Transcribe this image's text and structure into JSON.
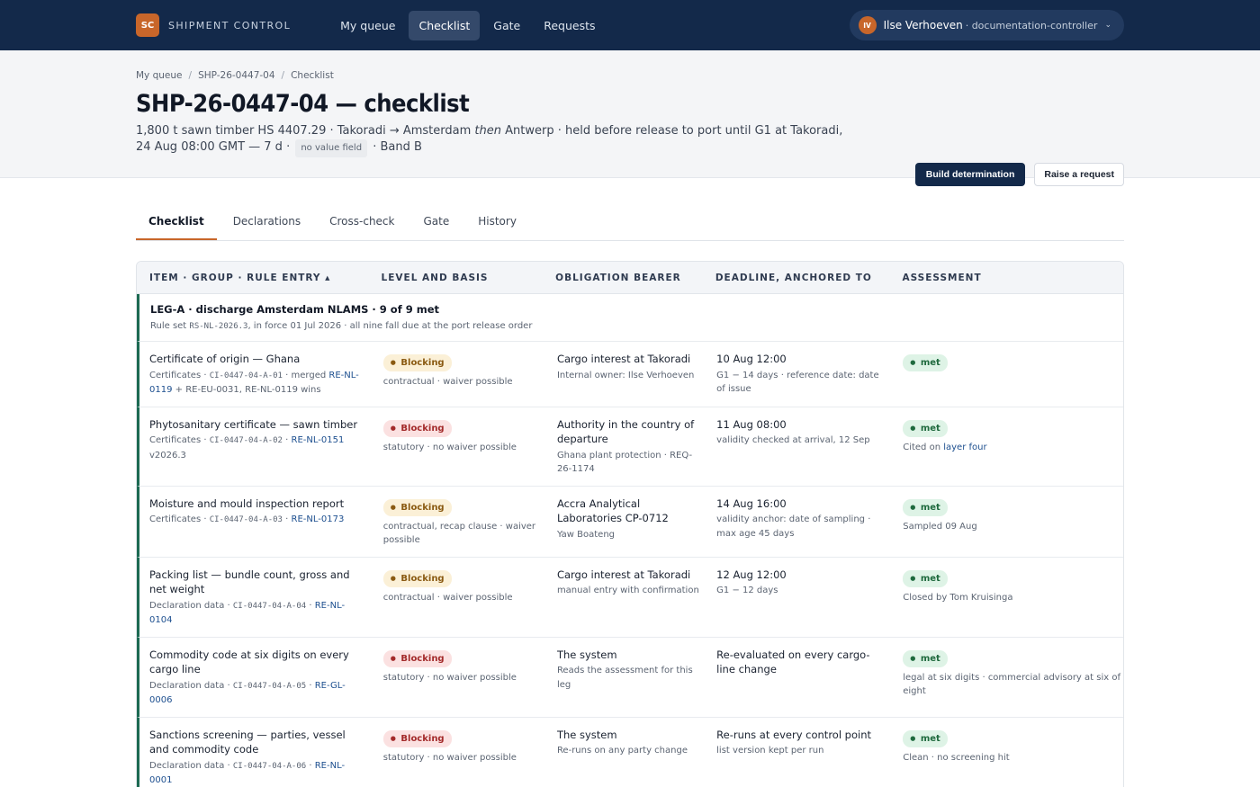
{
  "app": {
    "logo": "SC",
    "brand": "SHIPMENT CONTROL"
  },
  "nav": [
    "My queue",
    "Checklist",
    "Gate",
    "Requests"
  ],
  "user": {
    "initials": "IV",
    "name": "Ilse Verhoeven",
    "role": "· documentation-controller"
  },
  "breadcrumb": [
    "My queue",
    "SHP-26-0447-04",
    "Checklist"
  ],
  "page": {
    "title": "SHP-26-0447-04 — checklist",
    "subtitle_a": "1,800 t sawn timber HS 4407.29 · Takoradi → Amsterdam ",
    "subtitle_then": "then",
    "subtitle_b": " Antwerp · held before release to port until G1 at Takoradi, 24 Aug 08:00 GMT — 7 d ·",
    "pill": "no value field",
    "subtitle_c": "· Band B"
  },
  "actions": {
    "primary": "Build determination",
    "secondary": "Raise a request"
  },
  "tabs": [
    "Checklist",
    "Declarations",
    "Cross-check",
    "Gate",
    "History"
  ],
  "columns": [
    "ITEM · GROUP · RULE ENTRY ▴",
    "LEVEL AND BASIS",
    "OBLIGATION BEARER",
    "DEADLINE, ANCHORED TO",
    "ASSESSMENT"
  ],
  "group": {
    "title": "LEG-A · discharge Amsterdam NLAMS · 9 of 9 met",
    "sub_a": "Rule set ",
    "sub_code": "RS-NL-2026.3",
    "sub_b": ", in force 01 Jul 2026 · all nine fall due at the port release order"
  },
  "rows": [
    {
      "item": "Certificate of origin — Ghana",
      "meta_a": "Certificates · ",
      "code": "CI-0447-04-A-01",
      "meta_b": " · merged ",
      "link": "RE-NL-0119",
      "meta_c": " + RE-EU-0031, RE-NL-0119 wins",
      "badge": "Blocking",
      "tone": "amber",
      "basis": "contractual · waiver possible",
      "bearer": "Cargo interest at Takoradi",
      "bearer_sub": "Internal owner: Ilse Verhoeven",
      "deadline": "10 Aug 12:00",
      "deadline_sub": "G1 − 14 days · reference date: date of issue",
      "status": "met",
      "note_a": "",
      "note_link": "",
      "note_b": ""
    },
    {
      "item": "Phytosanitary certificate — sawn timber",
      "meta_a": "Certificates · ",
      "code": "CI-0447-04-A-02",
      "meta_b": " · ",
      "link": "RE-NL-0151",
      "meta_c": " v2026.3",
      "badge": "Blocking",
      "tone": "red",
      "basis": "statutory · no waiver possible",
      "bearer": "Authority in the country of departure",
      "bearer_sub": "Ghana plant protection · REQ-26-1174",
      "deadline": "11 Aug 08:00",
      "deadline_sub": "validity checked at arrival, 12 Sep",
      "status": "met",
      "note_a": "Cited on ",
      "note_link": "layer four",
      "note_b": ""
    },
    {
      "item": "Moisture and mould inspection report",
      "meta_a": "Certificates · ",
      "code": "CI-0447-04-A-03",
      "meta_b": " · ",
      "link": "RE-NL-0173",
      "meta_c": "",
      "badge": "Blocking",
      "tone": "amber",
      "basis": "contractual, recap clause · waiver possible",
      "bearer": "Accra Analytical Laboratories CP-0712",
      "bearer_sub": "Yaw Boateng",
      "deadline": "14 Aug 16:00",
      "deadline_sub": "validity anchor: date of sampling · max age 45 days",
      "status": "met",
      "note_a": "Sampled 09 Aug",
      "note_link": "",
      "note_b": ""
    },
    {
      "item": "Packing list — bundle count, gross and net weight",
      "meta_a": "Declaration data · ",
      "code": "CI-0447-04-A-04",
      "meta_b": " · ",
      "link": "RE-NL-0104",
      "meta_c": "",
      "badge": "Blocking",
      "tone": "amber",
      "basis": "contractual · waiver possible",
      "bearer": "Cargo interest at Takoradi",
      "bearer_sub": "manual entry with confirmation",
      "deadline": "12 Aug 12:00",
      "deadline_sub": "G1 − 12 days",
      "status": "met",
      "note_a": "Closed by Tom Kruisinga",
      "note_link": "",
      "note_b": ""
    },
    {
      "item": "Commodity code at six digits on every cargo line",
      "meta_a": "Declaration data · ",
      "code": "CI-0447-04-A-05",
      "meta_b": " · ",
      "link": "RE-GL-0006",
      "meta_c": "",
      "badge": "Blocking",
      "tone": "red",
      "basis": "statutory · no waiver possible",
      "bearer": "The system",
      "bearer_sub": "Reads the assessment for this leg",
      "deadline": "Re-evaluated on every cargo-line change",
      "deadline_sub": "",
      "status": "met",
      "note_a": "legal at six digits · commercial advisory at six of eight",
      "note_link": "",
      "note_b": ""
    },
    {
      "item": "Sanctions screening — parties, vessel and commodity code",
      "meta_a": "Declaration data · ",
      "code": "CI-0447-04-A-06",
      "meta_b": " · ",
      "link": "RE-NL-0001",
      "meta_c": "",
      "badge": "Blocking",
      "tone": "red",
      "basis": "statutory · no waiver possible",
      "bearer": "The system",
      "bearer_sub": "Re-runs on any party change",
      "deadline": "Re-runs at every control point",
      "deadline_sub": "list version kept per run",
      "status": "met",
      "note_a": "Clean · no screening hit",
      "note_link": "",
      "note_b": ""
    }
  ]
}
